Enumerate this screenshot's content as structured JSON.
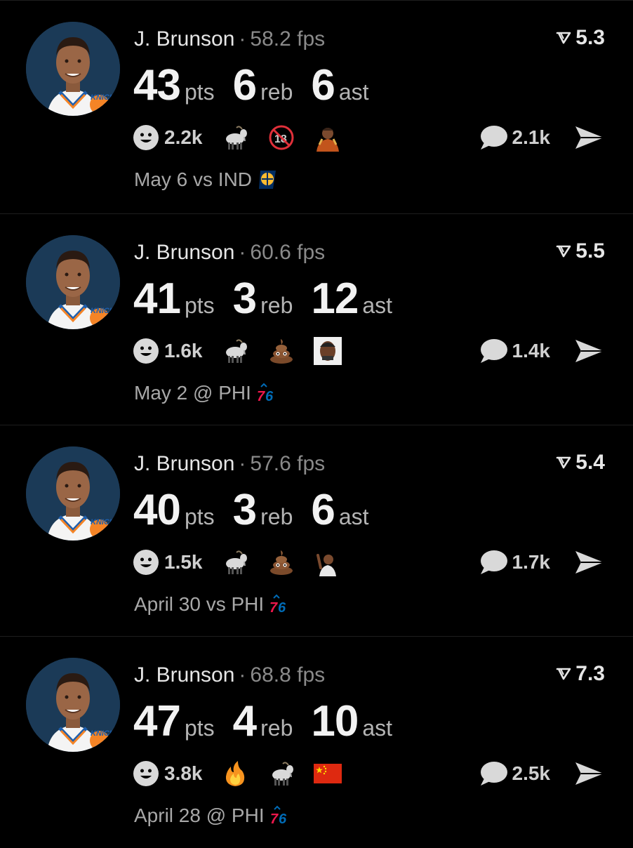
{
  "posts": [
    {
      "player": "J. Brunson",
      "separator": "·",
      "fps": "58.2 fps",
      "rating": "5.3",
      "stats": [
        {
          "value": "43",
          "unit": "pts"
        },
        {
          "value": "6",
          "unit": "reb"
        },
        {
          "value": "6",
          "unit": "ast"
        }
      ],
      "reactions_count": "2.2k",
      "reaction_icons": [
        "goat-icon",
        "no-18-icon",
        "player-reaction-icon"
      ],
      "comments_count": "2.1k",
      "game": "May 6 vs IND",
      "team_logo": "pacers-logo-icon"
    },
    {
      "player": "J. Brunson",
      "separator": "·",
      "fps": "60.6 fps",
      "rating": "5.5",
      "stats": [
        {
          "value": "41",
          "unit": "pts"
        },
        {
          "value": "3",
          "unit": "reb"
        },
        {
          "value": "12",
          "unit": "ast"
        }
      ],
      "reactions_count": "1.6k",
      "reaction_icons": [
        "goat-icon",
        "poop-icon",
        "player-face-icon"
      ],
      "comments_count": "1.4k",
      "game": "May 2 @ PHI",
      "team_logo": "76ers-logo-icon"
    },
    {
      "player": "J. Brunson",
      "separator": "·",
      "fps": "57.6 fps",
      "rating": "5.4",
      "stats": [
        {
          "value": "40",
          "unit": "pts"
        },
        {
          "value": "3",
          "unit": "reb"
        },
        {
          "value": "6",
          "unit": "ast"
        }
      ],
      "reactions_count": "1.5k",
      "reaction_icons": [
        "goat-icon",
        "poop-icon",
        "player-celebrate-icon"
      ],
      "comments_count": "1.7k",
      "game": "April 30 vs PHI",
      "team_logo": "76ers-logo-icon"
    },
    {
      "player": "J. Brunson",
      "separator": "·",
      "fps": "68.8 fps",
      "rating": "7.3",
      "stats": [
        {
          "value": "47",
          "unit": "pts"
        },
        {
          "value": "4",
          "unit": "reb"
        },
        {
          "value": "10",
          "unit": "ast"
        }
      ],
      "reactions_count": "3.8k",
      "reaction_icons": [
        "fire-icon",
        "goat-icon",
        "china-flag-icon"
      ],
      "comments_count": "2.5k",
      "game": "April 28 @ PHI",
      "team_logo": "76ers-logo-icon"
    }
  ],
  "colors": {
    "background": "#000000",
    "primary_text": "#f2f2f2",
    "secondary_text": "#8a8a8a",
    "avatar_bg": "#1b3a57"
  }
}
